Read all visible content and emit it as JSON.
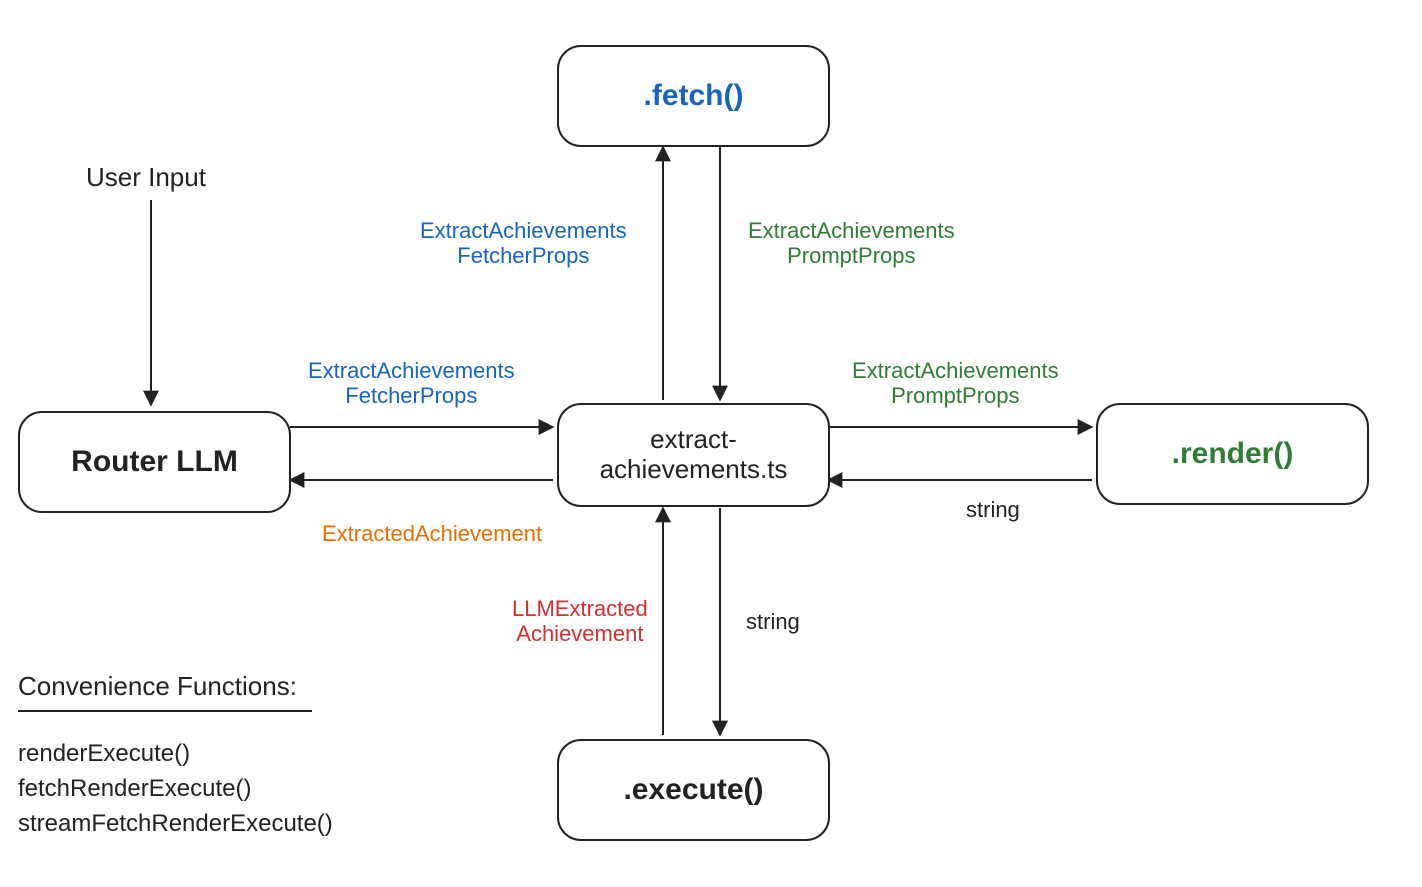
{
  "nodes": {
    "fetch": {
      "label": ".fetch()"
    },
    "render": {
      "label": ".render()"
    },
    "execute": {
      "label": ".execute()"
    },
    "center": {
      "line1": "extract-",
      "line2": "achievements.ts"
    },
    "router": {
      "label": "Router LLM"
    }
  },
  "labels": {
    "user_input": "User Input",
    "top_left": "ExtractAchievements\nFetcherProps",
    "top_right": "ExtractAchievements\nPromptProps",
    "left_top": "ExtractAchievements\nFetcherProps",
    "left_bottom": "ExtractedAchievement",
    "right_top": "ExtractAchievements\nPromptProps",
    "right_bottom": "string",
    "bottom_left": "LLMExtracted\nAchievement",
    "bottom_right": "string"
  },
  "footer": {
    "title": "Convenience Functions:",
    "fn1": "renderExecute()",
    "fn2": "fetchRenderExecute()",
    "fn3": "streamFetchRenderExecute()"
  },
  "colors": {
    "blue": "#1565C0",
    "green": "#2E7D32",
    "orange": "#EF6C00",
    "red": "#D32F2F",
    "black": "#222222"
  }
}
